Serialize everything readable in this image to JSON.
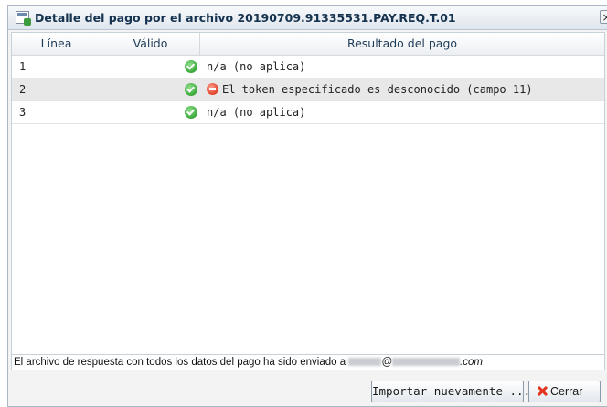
{
  "dialog": {
    "title": "Detalle del pago por el archivo 20190709.91335531.PAY.REQ.T.01",
    "close_glyph": "×"
  },
  "table": {
    "headers": [
      "Línea",
      "Válido",
      "Resultado del pago"
    ],
    "rows": [
      {
        "line": "1",
        "valid": "ok-icon",
        "result": "n/a (no aplica)",
        "result_icon": null
      },
      {
        "line": "2",
        "valid": "ok-icon",
        "result": "El token especificado es desconocido (campo 11)",
        "result_icon": "error-icon"
      },
      {
        "line": "3",
        "valid": "ok-icon",
        "result": "n/a (no aplica)",
        "result_icon": null
      }
    ]
  },
  "status": {
    "prefix": "El archivo de respuesta con todos los datos del pago ha sido enviado a ",
    "at": "@",
    "suffix": ".com"
  },
  "buttons": {
    "import": "Importar nuevamente ...",
    "close": "Cerrar"
  },
  "colors": {
    "valid_icon": "#3aa83a",
    "error_icon": "#e0432a",
    "close_icon": "#e2341f"
  }
}
